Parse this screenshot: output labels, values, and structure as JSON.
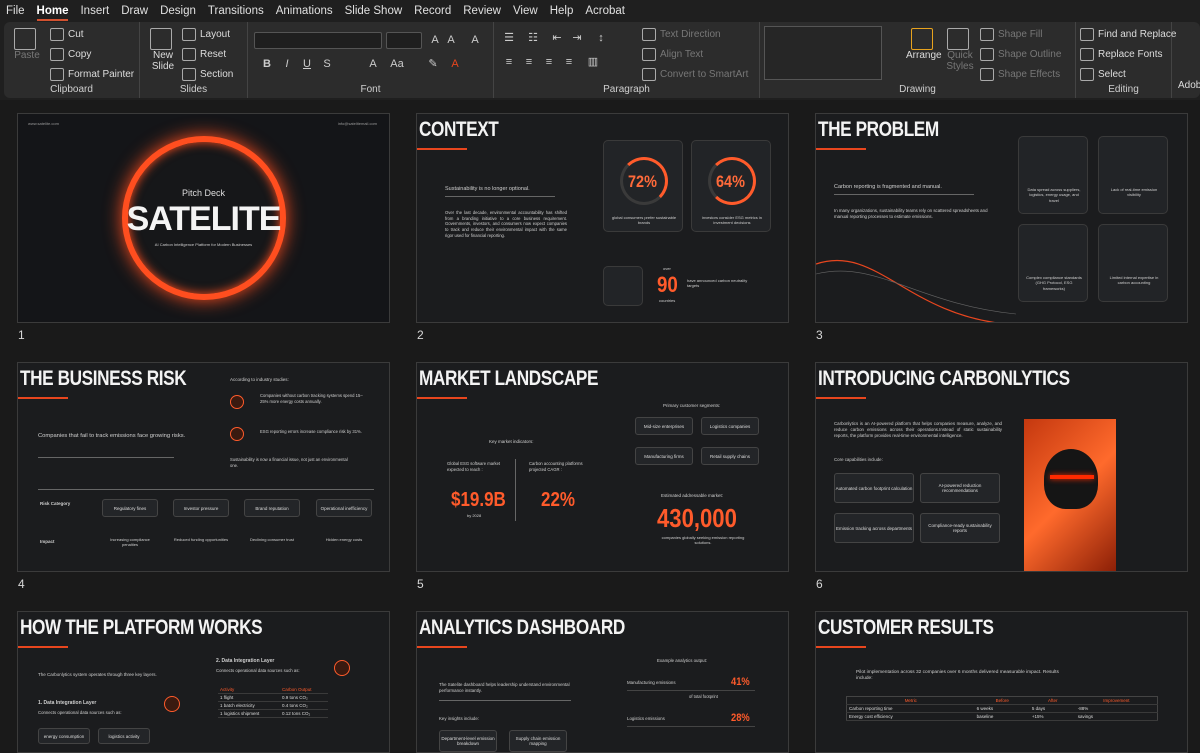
{
  "menu": [
    "File",
    "Home",
    "Insert",
    "Draw",
    "Design",
    "Transitions",
    "Animations",
    "Slide Show",
    "Record",
    "Review",
    "View",
    "Help",
    "Acrobat"
  ],
  "ribbon": {
    "clipboard": {
      "paste": "Paste",
      "cut": "Cut",
      "copy": "Copy",
      "format_painter": "Format Painter",
      "label": "Clipboard"
    },
    "slides": {
      "new_slide": "New Slide",
      "layout": "Layout",
      "reset": "Reset",
      "section": "Section",
      "label": "Slides"
    },
    "font": {
      "label": "Font"
    },
    "paragraph": {
      "text_direction": "Text Direction",
      "align_text": "Align Text",
      "convert_smartart": "Convert to SmartArt",
      "label": "Paragraph"
    },
    "drawing": {
      "arrange": "Arrange",
      "quick_styles": "Quick Styles",
      "shape_fill": "Shape Fill",
      "shape_outline": "Shape Outline",
      "shape_effects": "Shape Effects",
      "label": "Drawing"
    },
    "editing": {
      "find_replace": "Find and Replace",
      "replace_fonts": "Replace Fonts",
      "select": "Select",
      "label": "Editing"
    },
    "adobe": "Adob"
  },
  "slides": [
    {
      "n": "1",
      "site": "www.satelite.com",
      "email": "info@satelitemail.com",
      "pitch": "Pitch Deck",
      "title": "SATELITE",
      "tagline": "AI Carbon Intelligence Platform for Modern Businesses"
    },
    {
      "n": "2",
      "title": "CONTEXT",
      "sub": "Sustainability is no longer optional.",
      "body": "Over the last decade, environmental accountability has shifted from a branding initiative to a core business requirement. Governments, investors, and consumers now expect companies to track and reduce their environmental impact with the same rigor used for financial reporting.",
      "stat1": "72%",
      "stat1_text": "global consumers prefer sustainable brands",
      "stat2": "64%",
      "stat2_text": "investors consider ESG metrics in investment decisions",
      "over": "over",
      "stat3": "90",
      "countries": "countries",
      "stat3_text": "have announced carbon neutrality targets"
    },
    {
      "n": "3",
      "title": "THE PROBLEM",
      "sub": "Carbon reporting is fragmented and manual.",
      "body": "In many organizations, sustainability teams rely on scattered spreadsheets and manual reporting processes to estimate emissions.",
      "c1": "Data spread across suppliers, logistics, energy usage, and travel",
      "c2": "Lack of real-time emission visibility",
      "c3": "Complex compliance standards (GHG Protocol, ESG frameworks)",
      "c4": "Limited internal expertise in carbon accounting"
    },
    {
      "n": "4",
      "title": "THE BUSINESS RISK",
      "intro": "According to industry studies:",
      "r1": "Companies without carbon tracking systems spend 15–25% more energy costs annually.",
      "r2": "ESG reporting errors increase compliance risk by 31%.",
      "r3": "Sustainability is now a financial issue, not just an environmental one.",
      "lead": "Companies that fail to track emissions face growing risks.",
      "risk_label": "Risk Category",
      "impact_label": "Impact",
      "risks": [
        "Regulatory fines",
        "Investor pressure",
        "Brand reputation",
        "Operational inefficiency"
      ],
      "impacts": [
        "Increasing compliance penalties",
        "Reduced funding opportunities",
        "Declining consumer trust",
        "Hidden energy costs"
      ]
    },
    {
      "n": "5",
      "title": "MARKET LANDSCAPE",
      "key": "Key market indicators:",
      "m1": "Global ESG software market expected to reach :",
      "m1v": "$19.9B",
      "m1y": "by 2028",
      "m2": "Carbon accounting platforms projected CAGR :",
      "m2v": "22%",
      "seg": "Primary customer segments:",
      "segs": [
        "Mid-size enterprises",
        "Logistics companies",
        "Manufacturing firms",
        "Retail supply chains"
      ],
      "addr": "Estimated addressable market:",
      "addrv": "430,000",
      "addr_text": "companies globally seeking emission reporting solutions."
    },
    {
      "n": "6",
      "title": "INTRODUCING CARBONLYTICS",
      "body": "Carbonlytics is an AI-powered platform that helps companies measure, analyze, and reduce carbon emissions across their operations.Instead of static sustainability reports, the platform provides real-time environmental intelligence.",
      "core": "Core capabilities include:",
      "caps": [
        "Automated carbon footprint calculation",
        "AI-powered reduction recommendations",
        "Emission tracking across departments",
        "Compliance-ready sustainability reports"
      ]
    },
    {
      "n": "7",
      "title": "HOW THE PLATFORM WORKS",
      "intro": "The Carbonlytics system operates through three key layers.",
      "l1": "1. Data Integration Layer",
      "l1_text": "Connects operational data sources such as:",
      "l2": "2. Data Integration Layer",
      "l2_text": "Connects operational data sources such as:",
      "chips": [
        "energy consumption",
        "logistics activity"
      ],
      "th": [
        "Activity",
        "Carbon Output"
      ],
      "rows": [
        [
          "1 flight",
          "0.9 tons CO₂"
        ],
        [
          "1 batch electricity",
          "0.4 tons CO₂"
        ],
        [
          "1 logistics shipment",
          "0.12 tons CO₂"
        ]
      ]
    },
    {
      "n": "8",
      "title": "ANALYTICS DASHBOARD",
      "body": "The Satelite dashboard helps leadership understand environmental performance instantly.",
      "example": "Example analytics output:",
      "e1": "Manufacturing emissions",
      "e1v": "41%",
      "total": "of total footprint",
      "e2": "Logistics emissions",
      "e2v": "28%",
      "insights": "Key insights include:",
      "chips": [
        "Department-level emission breakdown",
        "Supply chain emission mapping"
      ]
    },
    {
      "n": "9",
      "title": "CUSTOMER RESULTS",
      "body": "Pilot implementation across 32 companies over 6 months delivered measurable impact. Results include:",
      "th": [
        "Metric",
        "Before",
        "After",
        "Improvement"
      ],
      "rows": [
        [
          "Carbon reporting time",
          "6 weeks",
          "5 days",
          "-88%"
        ],
        [
          "Energy cost efficiency",
          "baseline",
          "+15%",
          "savings"
        ]
      ]
    }
  ]
}
